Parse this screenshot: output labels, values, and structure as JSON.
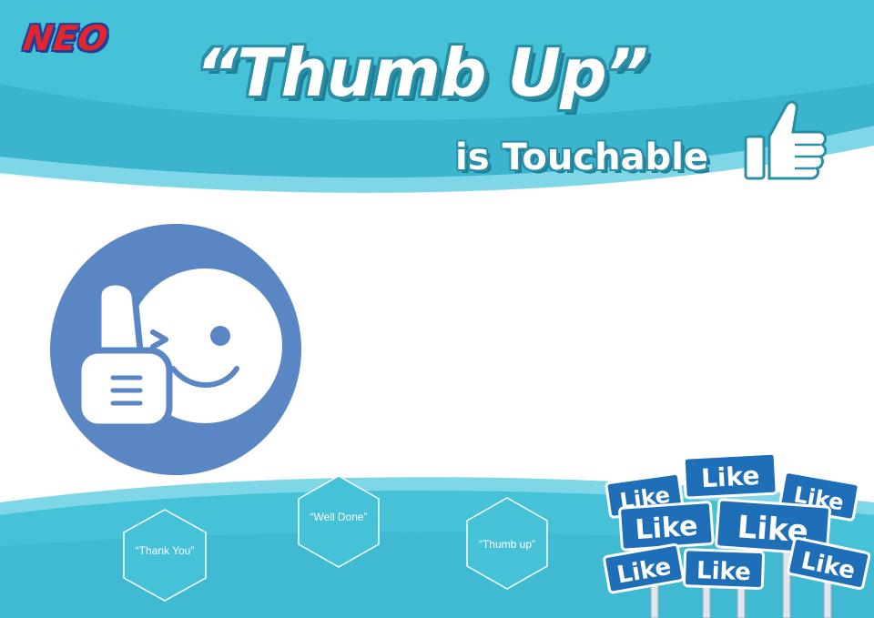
{
  "brand": {
    "logo_text": "NEO"
  },
  "header": {
    "title": "“Thumb Up”",
    "subtitle": "is Touchable"
  },
  "hexagons": [
    {
      "label": "“Thank You”"
    },
    {
      "label": "“Well Done”"
    },
    {
      "label": "“Thumb up”"
    }
  ],
  "signs": {
    "label": "Like"
  },
  "colors": {
    "header_teal": "#45c1d8",
    "header_light": "#7fd6e6",
    "emoji_circle": "#5b86c4",
    "sign_blue": "#1f6fb8"
  },
  "icons": [
    "thumbs-up-icon",
    "winking-face-thumbs-up-icon"
  ]
}
